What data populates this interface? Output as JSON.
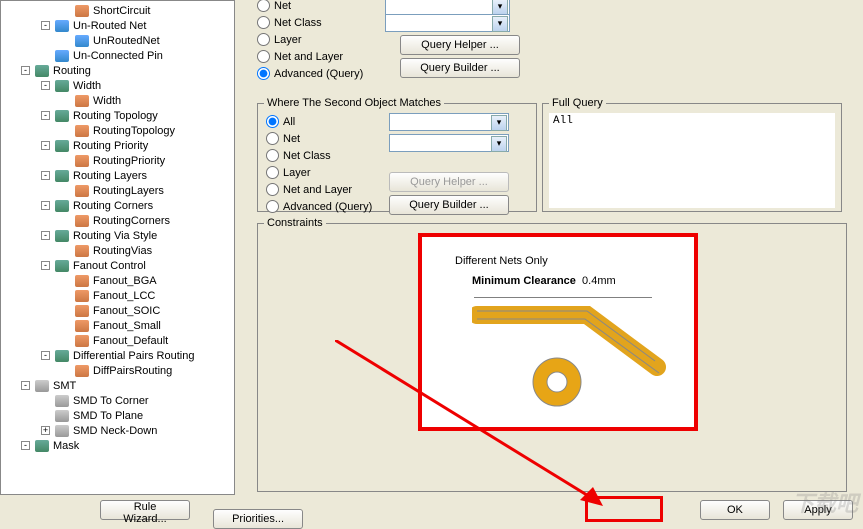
{
  "tree": [
    {
      "pad": 60,
      "exp": false,
      "ico": "leaf",
      "label": "ShortCircuit"
    },
    {
      "pad": 40,
      "exp": "-",
      "ico": "blue",
      "label": "Un-Routed Net"
    },
    {
      "pad": 60,
      "exp": false,
      "ico": "blue",
      "label": "UnRoutedNet"
    },
    {
      "pad": 40,
      "exp": false,
      "ico": "blue",
      "label": "Un-Connected Pin"
    },
    {
      "pad": 20,
      "exp": "-",
      "ico": "node",
      "label": "Routing"
    },
    {
      "pad": 40,
      "exp": "-",
      "ico": "node",
      "label": "Width"
    },
    {
      "pad": 60,
      "exp": false,
      "ico": "leaf",
      "label": "Width"
    },
    {
      "pad": 40,
      "exp": "-",
      "ico": "node",
      "label": "Routing Topology"
    },
    {
      "pad": 60,
      "exp": false,
      "ico": "leaf",
      "label": "RoutingTopology"
    },
    {
      "pad": 40,
      "exp": "-",
      "ico": "node",
      "label": "Routing Priority"
    },
    {
      "pad": 60,
      "exp": false,
      "ico": "leaf",
      "label": "RoutingPriority"
    },
    {
      "pad": 40,
      "exp": "-",
      "ico": "node",
      "label": "Routing Layers"
    },
    {
      "pad": 60,
      "exp": false,
      "ico": "leaf",
      "label": "RoutingLayers"
    },
    {
      "pad": 40,
      "exp": "-",
      "ico": "node",
      "label": "Routing Corners"
    },
    {
      "pad": 60,
      "exp": false,
      "ico": "leaf",
      "label": "RoutingCorners"
    },
    {
      "pad": 40,
      "exp": "-",
      "ico": "node",
      "label": "Routing Via Style"
    },
    {
      "pad": 60,
      "exp": false,
      "ico": "leaf",
      "label": "RoutingVias"
    },
    {
      "pad": 40,
      "exp": "-",
      "ico": "node",
      "label": "Fanout Control"
    },
    {
      "pad": 60,
      "exp": false,
      "ico": "leaf",
      "label": "Fanout_BGA"
    },
    {
      "pad": 60,
      "exp": false,
      "ico": "leaf",
      "label": "Fanout_LCC"
    },
    {
      "pad": 60,
      "exp": false,
      "ico": "leaf",
      "label": "Fanout_SOIC"
    },
    {
      "pad": 60,
      "exp": false,
      "ico": "leaf",
      "label": "Fanout_Small"
    },
    {
      "pad": 60,
      "exp": false,
      "ico": "leaf",
      "label": "Fanout_Default"
    },
    {
      "pad": 40,
      "exp": "-",
      "ico": "node",
      "label": "Differential Pairs Routing"
    },
    {
      "pad": 60,
      "exp": false,
      "ico": "leaf",
      "label": "DiffPairsRouting"
    },
    {
      "pad": 20,
      "exp": "-",
      "ico": "gray",
      "label": "SMT"
    },
    {
      "pad": 40,
      "exp": false,
      "ico": "gray",
      "label": "SMD To Corner"
    },
    {
      "pad": 40,
      "exp": false,
      "ico": "gray",
      "label": "SMD To Plane"
    },
    {
      "pad": 40,
      "exp": "+",
      "ico": "gray",
      "label": "SMD Neck-Down"
    },
    {
      "pad": 20,
      "exp": "-",
      "ico": "node",
      "label": "Mask"
    }
  ],
  "first_matches": {
    "options": [
      "Net",
      "Net Class",
      "Layer",
      "Net and Layer",
      "Advanced (Query)"
    ],
    "selected": "Advanced (Query)",
    "query_helper": "Query Helper ...",
    "query_builder": "Query Builder ..."
  },
  "second_matches": {
    "legend": "Where The Second Object Matches",
    "options": [
      "All",
      "Net",
      "Net Class",
      "Layer",
      "Net and Layer",
      "Advanced (Query)"
    ],
    "selected": "All",
    "query_helper": "Query Helper ...",
    "query_builder": "Query Builder ..."
  },
  "full_query": {
    "legend": "Full Query",
    "text": "All"
  },
  "constraints": {
    "legend": "Constraints",
    "title": "Different Nets Only",
    "label": "Minimum Clearance",
    "value": "0.4mm"
  },
  "buttons": {
    "rule_wizard": "Rule Wizard...",
    "priorities": "Priorities...",
    "ok": "OK",
    "apply": "Apply"
  },
  "watermark": "下载吧"
}
